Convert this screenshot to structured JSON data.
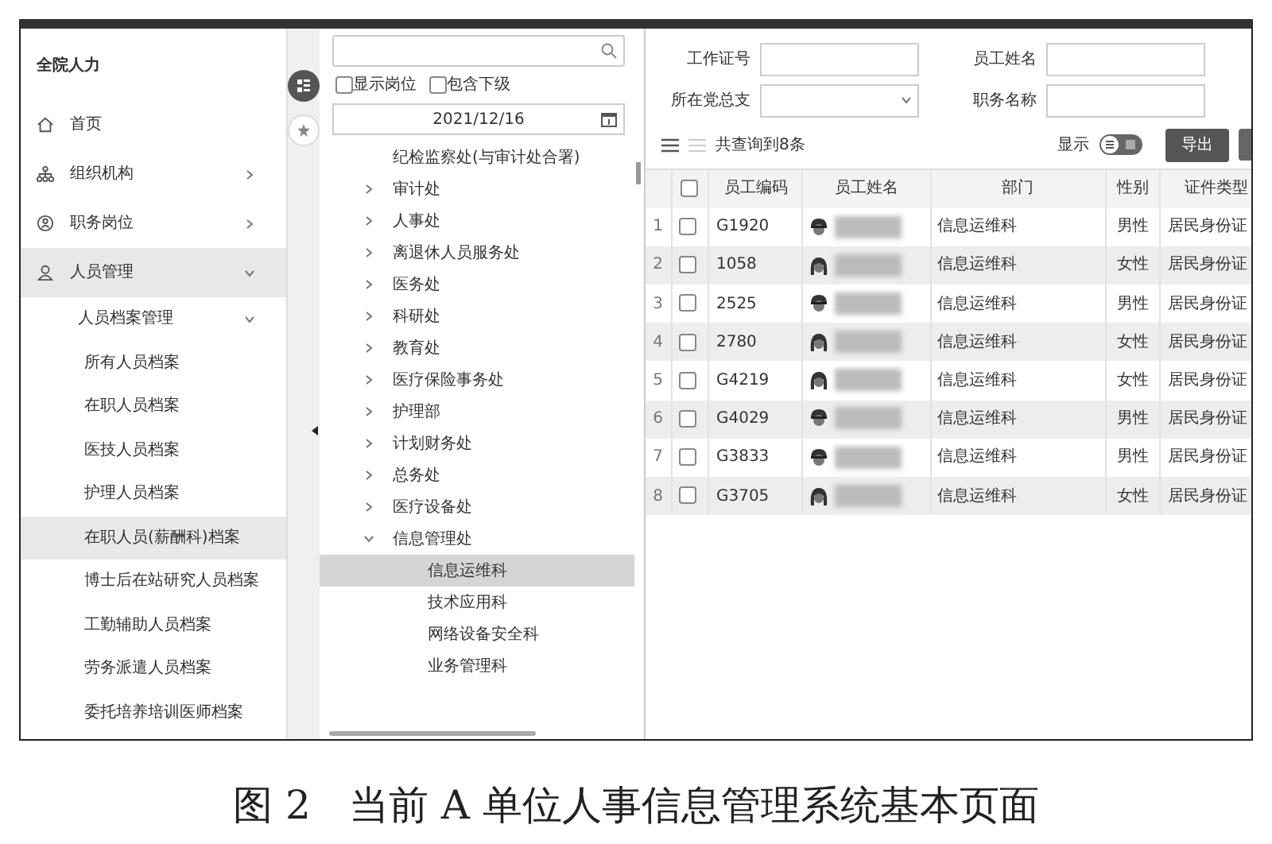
{
  "sidebar": {
    "title": "全院人力",
    "items": [
      {
        "label": "首页",
        "selected": false
      },
      {
        "label": "组织机构",
        "selected": false,
        "expanded": false
      },
      {
        "label": "职务岗位",
        "selected": false,
        "expanded": false
      },
      {
        "label": "人员管理",
        "selected": true,
        "expanded": true,
        "children": [
          {
            "label": "人员档案管理",
            "selected": false,
            "expanded": true,
            "children": [
              {
                "label": "所有人员档案",
                "selected": false
              },
              {
                "label": "在职人员档案",
                "selected": false
              },
              {
                "label": "医技人员档案",
                "selected": false
              },
              {
                "label": "护理人员档案",
                "selected": false
              },
              {
                "label": "在职人员(薪酬科)档案",
                "selected": true
              },
              {
                "label": "博士后在站研究人员档案",
                "selected": false
              },
              {
                "label": "工勤辅助人员档案",
                "selected": false
              },
              {
                "label": "劳务派遣人员档案",
                "selected": false
              },
              {
                "label": "委托培养培训医师档案",
                "selected": false
              }
            ]
          }
        ]
      }
    ]
  },
  "org_panel": {
    "options": [
      {
        "label": "显示岗位",
        "checked": false
      },
      {
        "label": "包含下级",
        "checked": false
      }
    ],
    "date": "2021/12/16",
    "tree": [
      {
        "label": "纪检监察处(与审计处合署)",
        "selected": false
      },
      {
        "label": "审计处",
        "selected": false,
        "expanded": false
      },
      {
        "label": "人事处",
        "selected": false,
        "expanded": false
      },
      {
        "label": "离退休人员服务处",
        "selected": false,
        "expanded": false
      },
      {
        "label": "医务处",
        "selected": false,
        "expanded": false
      },
      {
        "label": "科研处",
        "selected": false,
        "expanded": false
      },
      {
        "label": "教育处",
        "selected": false,
        "expanded": false
      },
      {
        "label": "医疗保险事务处",
        "selected": false,
        "expanded": false
      },
      {
        "label": "护理部",
        "selected": false,
        "expanded": false
      },
      {
        "label": "计划财务处",
        "selected": false,
        "expanded": false
      },
      {
        "label": "总务处",
        "selected": false,
        "expanded": false
      },
      {
        "label": "医疗设备处",
        "selected": false,
        "expanded": false
      },
      {
        "label": "信息管理处",
        "selected": false,
        "expanded": true,
        "children": [
          {
            "label": "信息运维科",
            "selected": true
          },
          {
            "label": "技术应用科",
            "selected": false
          },
          {
            "label": "网络设备安全科",
            "selected": false
          },
          {
            "label": "业务管理科",
            "selected": false
          }
        ]
      }
    ]
  },
  "filters": [
    {
      "label": "工作证号",
      "kind": "text"
    },
    {
      "label": "员工姓名",
      "kind": "text"
    },
    {
      "label": "所在党总支",
      "kind": "select"
    },
    {
      "label": "职务名称",
      "kind": "text"
    }
  ],
  "toolbar": {
    "count": "共查询到8条",
    "display_label": "显示",
    "view_toggle": {
      "on": false
    },
    "buttons": [
      "导出"
    ]
  },
  "table": {
    "select_all_checked": false,
    "columns": [
      "员工编码",
      "员工姓名",
      "部门",
      "性别",
      "证件类型"
    ],
    "rows": [
      {
        "index": "1",
        "checked": false,
        "code": "G1920",
        "kind": "male",
        "department": "信息运维科",
        "gender": "男性",
        "id_type": "居民身份证"
      },
      {
        "index": "2",
        "checked": false,
        "code": "1058",
        "kind": "female",
        "department": "信息运维科",
        "gender": "女性",
        "id_type": "居民身份证"
      },
      {
        "index": "3",
        "checked": false,
        "code": "2525",
        "kind": "male",
        "department": "信息运维科",
        "gender": "男性",
        "id_type": "居民身份证"
      },
      {
        "index": "4",
        "checked": false,
        "code": "2780",
        "kind": "female",
        "department": "信息运维科",
        "gender": "女性",
        "id_type": "居民身份证"
      },
      {
        "index": "5",
        "checked": false,
        "code": "G4219",
        "kind": "female",
        "department": "信息运维科",
        "gender": "女性",
        "id_type": "居民身份证"
      },
      {
        "index": "6",
        "checked": false,
        "code": "G4029",
        "kind": "male",
        "department": "信息运维科",
        "gender": "男性",
        "id_type": "居民身份证"
      },
      {
        "index": "7",
        "checked": false,
        "code": "G3833",
        "kind": "male",
        "department": "信息运维科",
        "gender": "男性",
        "id_type": "居民身份证"
      },
      {
        "index": "8",
        "checked": false,
        "code": "G3705",
        "kind": "female",
        "department": "信息运维科",
        "gender": "女性",
        "id_type": "居民身份证"
      }
    ]
  },
  "caption": {
    "number": "图 2",
    "text": "当前 A 单位人事信息管理系统基本页面"
  }
}
